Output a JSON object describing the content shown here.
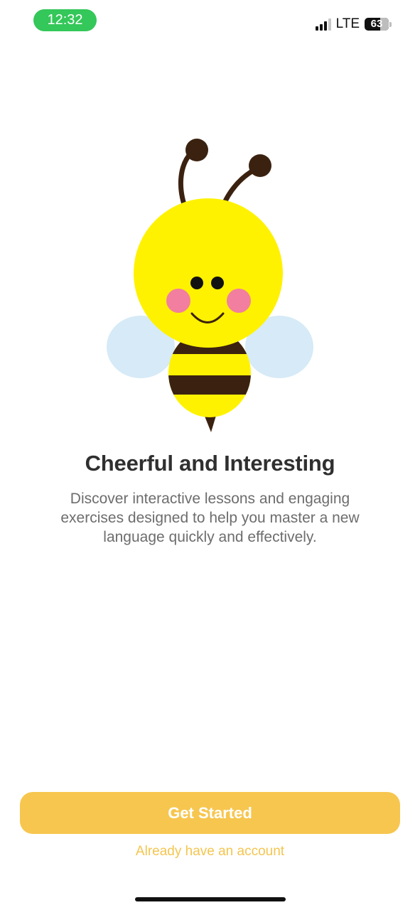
{
  "status_bar": {
    "time": "12:32",
    "network": "LTE",
    "battery_level": "63",
    "signal_icon": "cellular-signal-icon",
    "battery_icon": "battery-icon",
    "time_pill_color": "#34c759"
  },
  "onboarding": {
    "illustration": "bee-illustration",
    "title": "Cheerful and Interesting",
    "description": "Discover interactive lessons and engaging exercises designed to help you master a new language quickly and effectively."
  },
  "actions": {
    "primary_label": "Get Started",
    "secondary_label": "Already have an account"
  },
  "colors": {
    "accent": "#f7c64f",
    "link": "#f4c54f",
    "title": "#2f2f2f",
    "body": "#6d6d6d"
  }
}
